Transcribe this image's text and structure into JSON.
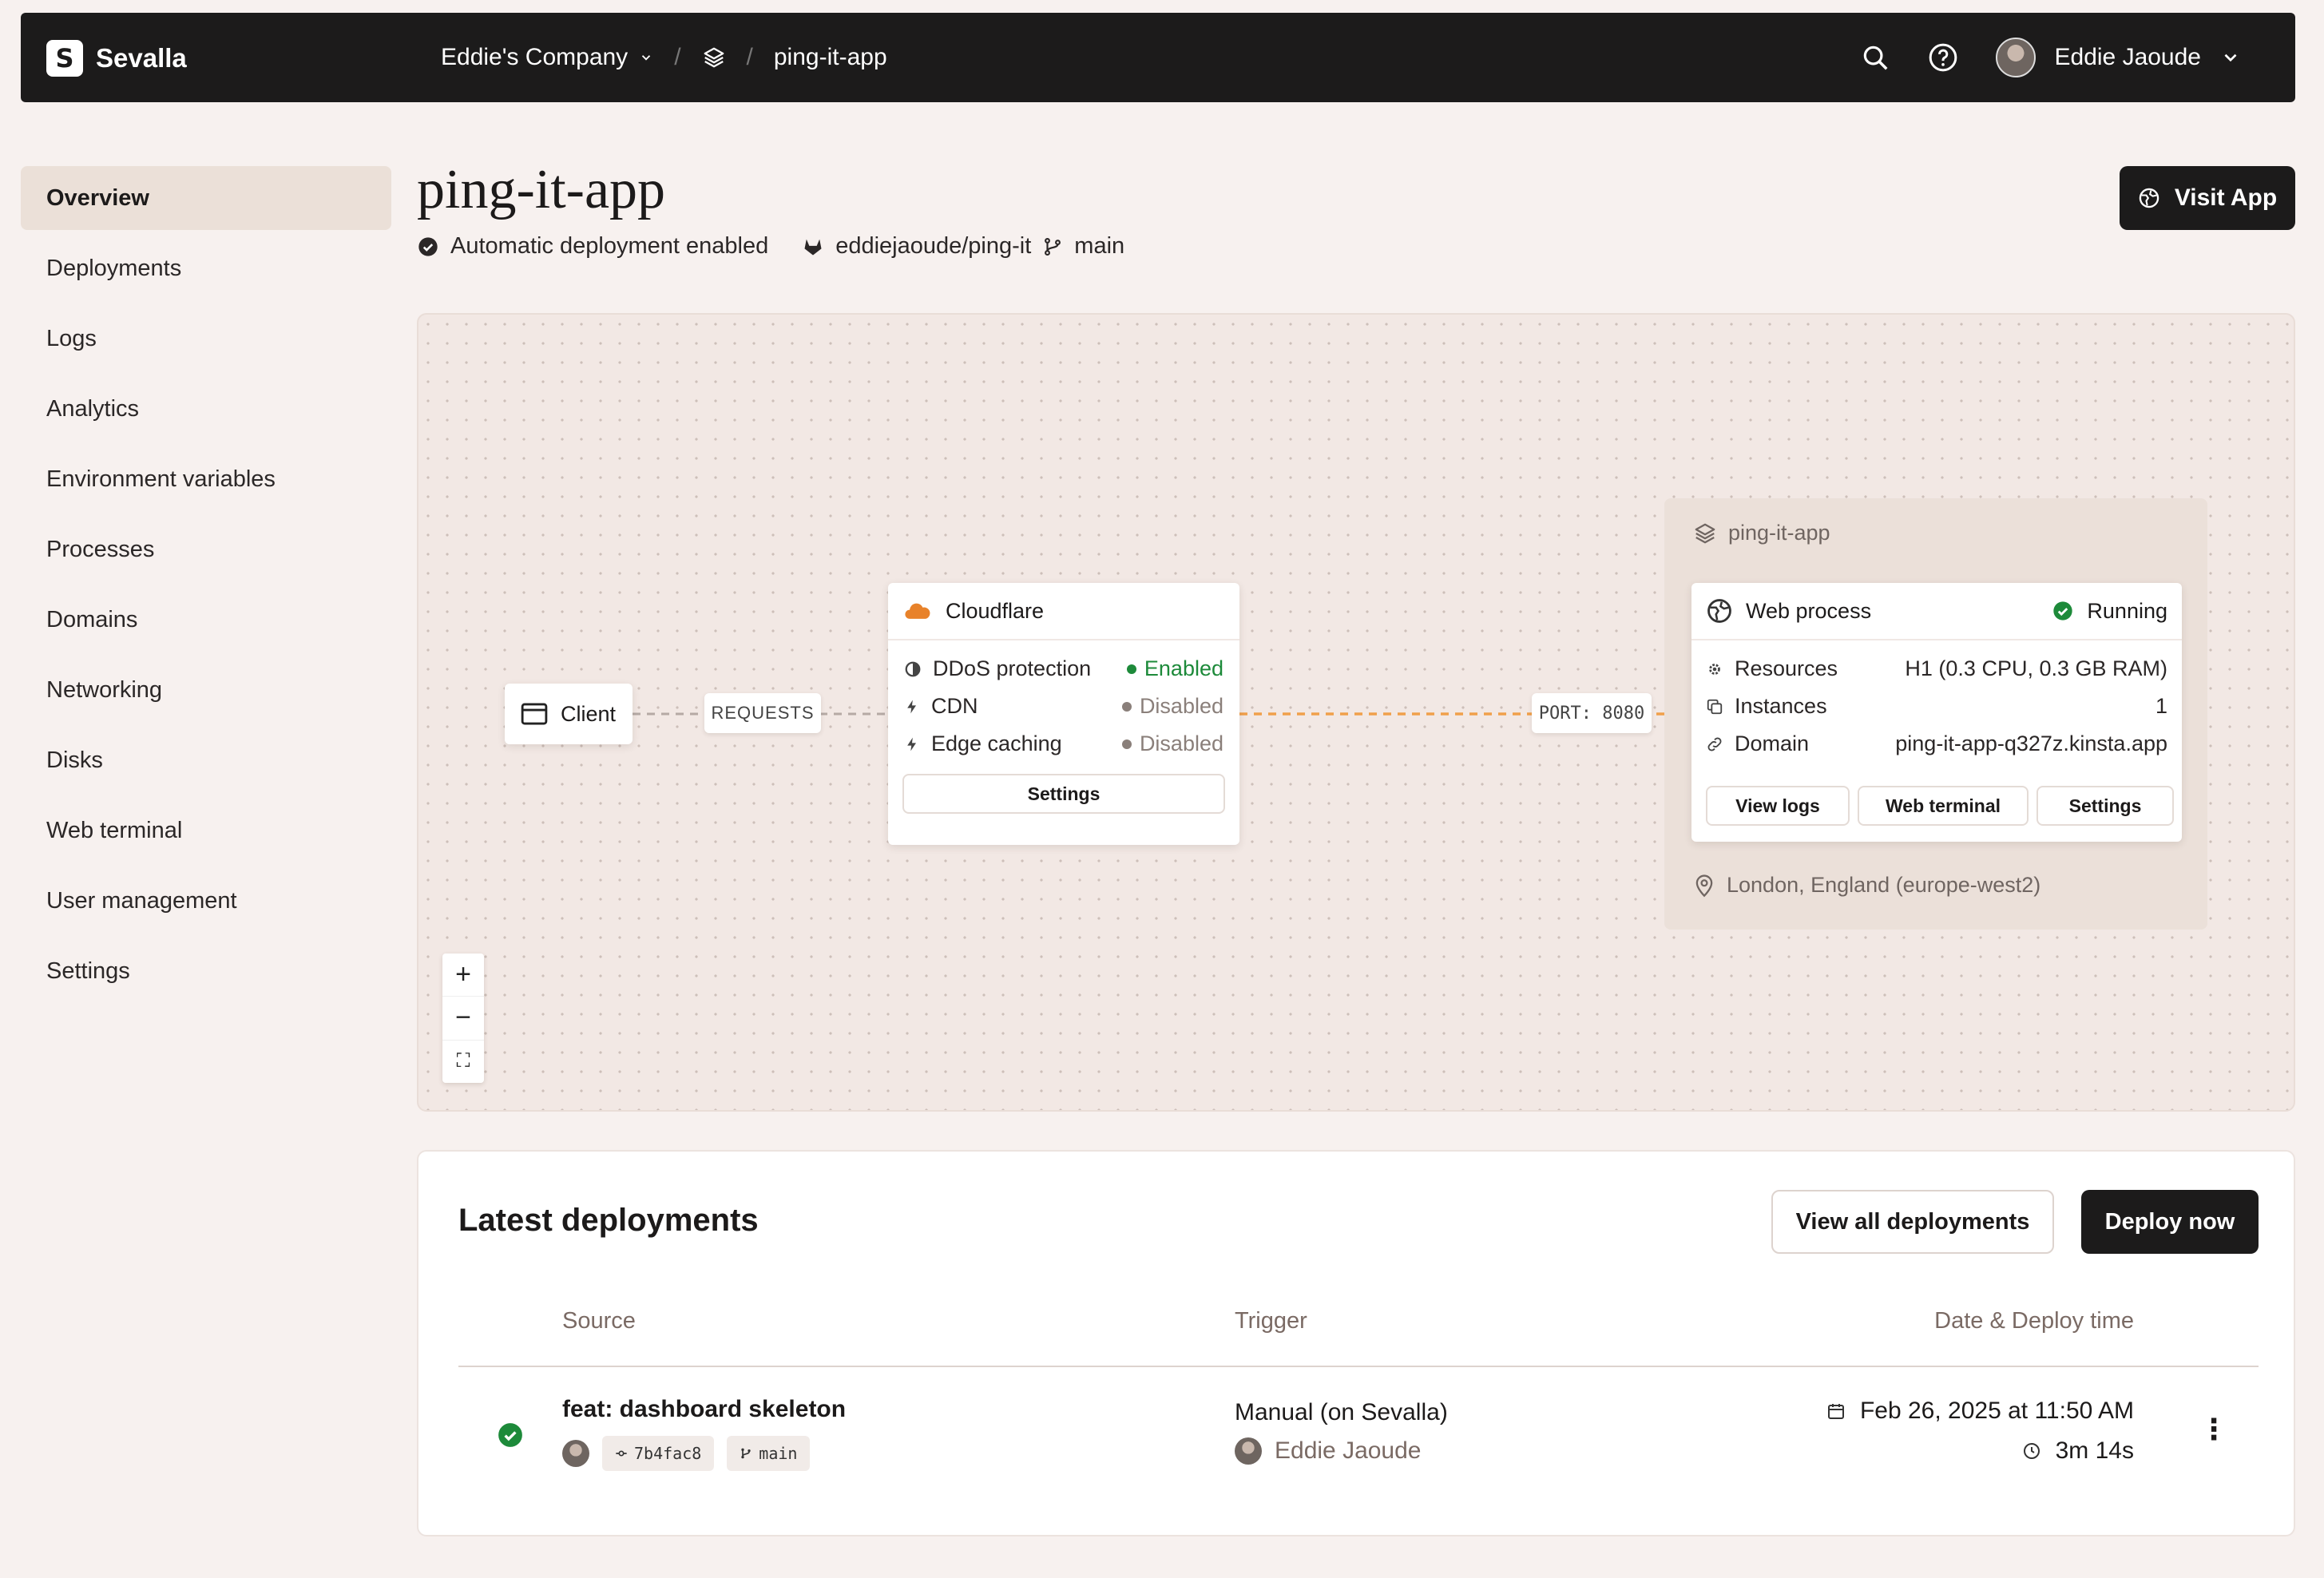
{
  "topbar": {
    "brand": "Sevalla",
    "brand_glyph": "S",
    "company": "Eddie's Company",
    "crumb_sep": "/",
    "app": "ping-it-app",
    "user": "Eddie Jaoude"
  },
  "sidebar": {
    "items": [
      {
        "label": "Overview",
        "active": true
      },
      {
        "label": "Deployments"
      },
      {
        "label": "Logs"
      },
      {
        "label": "Analytics"
      },
      {
        "label": "Environment variables"
      },
      {
        "label": "Processes"
      },
      {
        "label": "Domains"
      },
      {
        "label": "Networking"
      },
      {
        "label": "Disks"
      },
      {
        "label": "Web terminal"
      },
      {
        "label": "User management"
      },
      {
        "label": "Settings"
      }
    ]
  },
  "header": {
    "title": "ping-it-app",
    "auto_deploy": "Automatic deployment enabled",
    "repo": "eddiejaoude/ping-it",
    "branch": "main",
    "visit_label": "Visit App"
  },
  "diagram": {
    "client": "Client",
    "requests_tag": "REQUESTS",
    "port_tag": "PORT: 8080",
    "cloudflare": {
      "title": "Cloudflare",
      "rows": [
        {
          "label": "DDoS protection",
          "status": "Enabled"
        },
        {
          "label": "CDN",
          "status": "Disabled"
        },
        {
          "label": "Edge caching",
          "status": "Disabled"
        }
      ],
      "settings": "Settings"
    },
    "group_title": "ping-it-app",
    "web_process": {
      "title": "Web process",
      "status": "Running",
      "rows": [
        {
          "label": "Resources",
          "value": "H1 (0.3 CPU, 0.3 GB RAM)"
        },
        {
          "label": "Instances",
          "value": "1"
        },
        {
          "label": "Domain",
          "value": "ping-it-app-q327z.kinsta.app"
        }
      ],
      "buttons": [
        "View logs",
        "Web terminal",
        "Settings"
      ]
    },
    "location": "London, England (europe-west2)",
    "zoom": {
      "in": "+",
      "out": "−",
      "fit": "⛶"
    }
  },
  "deployments": {
    "title": "Latest deployments",
    "view_all": "View all deployments",
    "deploy_now": "Deploy now",
    "columns": [
      "Source",
      "Trigger",
      "Date & Deploy time"
    ],
    "rows": [
      {
        "commit": "feat: dashboard skeleton",
        "hash": "7b4fac8",
        "branch": "main",
        "trigger": "Manual (on Sevalla)",
        "user": "Eddie Jaoude",
        "date": "Feb 26, 2025 at 11:50 AM",
        "duration": "3m 14s",
        "menu": "⋮"
      }
    ]
  },
  "colors": {
    "accent_dark": "#1c1b1b",
    "success": "#1d8a3a",
    "cloudflare_orange": "#e8822a",
    "port_line": "#f0a04b"
  }
}
